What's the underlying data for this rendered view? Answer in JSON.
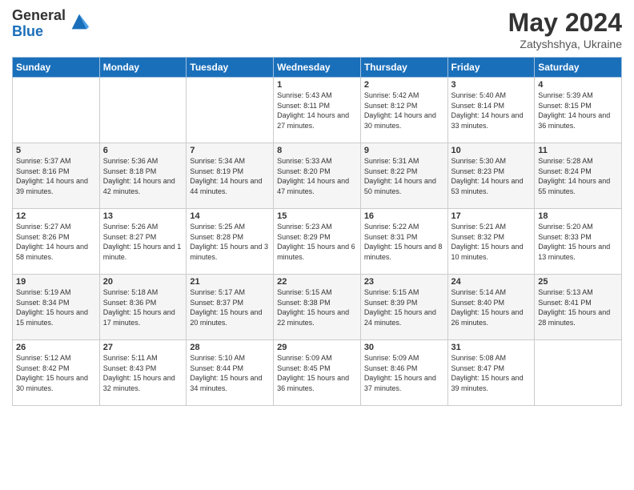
{
  "logo": {
    "general": "General",
    "blue": "Blue"
  },
  "header": {
    "month_year": "May 2024",
    "location": "Zatyshshya, Ukraine"
  },
  "days_of_week": [
    "Sunday",
    "Monday",
    "Tuesday",
    "Wednesday",
    "Thursday",
    "Friday",
    "Saturday"
  ],
  "weeks": [
    [
      {
        "day": "",
        "info": ""
      },
      {
        "day": "",
        "info": ""
      },
      {
        "day": "",
        "info": ""
      },
      {
        "day": "1",
        "info": "Sunrise: 5:43 AM\nSunset: 8:11 PM\nDaylight: 14 hours and 27 minutes."
      },
      {
        "day": "2",
        "info": "Sunrise: 5:42 AM\nSunset: 8:12 PM\nDaylight: 14 hours and 30 minutes."
      },
      {
        "day": "3",
        "info": "Sunrise: 5:40 AM\nSunset: 8:14 PM\nDaylight: 14 hours and 33 minutes."
      },
      {
        "day": "4",
        "info": "Sunrise: 5:39 AM\nSunset: 8:15 PM\nDaylight: 14 hours and 36 minutes."
      }
    ],
    [
      {
        "day": "5",
        "info": "Sunrise: 5:37 AM\nSunset: 8:16 PM\nDaylight: 14 hours and 39 minutes."
      },
      {
        "day": "6",
        "info": "Sunrise: 5:36 AM\nSunset: 8:18 PM\nDaylight: 14 hours and 42 minutes."
      },
      {
        "day": "7",
        "info": "Sunrise: 5:34 AM\nSunset: 8:19 PM\nDaylight: 14 hours and 44 minutes."
      },
      {
        "day": "8",
        "info": "Sunrise: 5:33 AM\nSunset: 8:20 PM\nDaylight: 14 hours and 47 minutes."
      },
      {
        "day": "9",
        "info": "Sunrise: 5:31 AM\nSunset: 8:22 PM\nDaylight: 14 hours and 50 minutes."
      },
      {
        "day": "10",
        "info": "Sunrise: 5:30 AM\nSunset: 8:23 PM\nDaylight: 14 hours and 53 minutes."
      },
      {
        "day": "11",
        "info": "Sunrise: 5:28 AM\nSunset: 8:24 PM\nDaylight: 14 hours and 55 minutes."
      }
    ],
    [
      {
        "day": "12",
        "info": "Sunrise: 5:27 AM\nSunset: 8:26 PM\nDaylight: 14 hours and 58 minutes."
      },
      {
        "day": "13",
        "info": "Sunrise: 5:26 AM\nSunset: 8:27 PM\nDaylight: 15 hours and 1 minute."
      },
      {
        "day": "14",
        "info": "Sunrise: 5:25 AM\nSunset: 8:28 PM\nDaylight: 15 hours and 3 minutes."
      },
      {
        "day": "15",
        "info": "Sunrise: 5:23 AM\nSunset: 8:29 PM\nDaylight: 15 hours and 6 minutes."
      },
      {
        "day": "16",
        "info": "Sunrise: 5:22 AM\nSunset: 8:31 PM\nDaylight: 15 hours and 8 minutes."
      },
      {
        "day": "17",
        "info": "Sunrise: 5:21 AM\nSunset: 8:32 PM\nDaylight: 15 hours and 10 minutes."
      },
      {
        "day": "18",
        "info": "Sunrise: 5:20 AM\nSunset: 8:33 PM\nDaylight: 15 hours and 13 minutes."
      }
    ],
    [
      {
        "day": "19",
        "info": "Sunrise: 5:19 AM\nSunset: 8:34 PM\nDaylight: 15 hours and 15 minutes."
      },
      {
        "day": "20",
        "info": "Sunrise: 5:18 AM\nSunset: 8:36 PM\nDaylight: 15 hours and 17 minutes."
      },
      {
        "day": "21",
        "info": "Sunrise: 5:17 AM\nSunset: 8:37 PM\nDaylight: 15 hours and 20 minutes."
      },
      {
        "day": "22",
        "info": "Sunrise: 5:15 AM\nSunset: 8:38 PM\nDaylight: 15 hours and 22 minutes."
      },
      {
        "day": "23",
        "info": "Sunrise: 5:15 AM\nSunset: 8:39 PM\nDaylight: 15 hours and 24 minutes."
      },
      {
        "day": "24",
        "info": "Sunrise: 5:14 AM\nSunset: 8:40 PM\nDaylight: 15 hours and 26 minutes."
      },
      {
        "day": "25",
        "info": "Sunrise: 5:13 AM\nSunset: 8:41 PM\nDaylight: 15 hours and 28 minutes."
      }
    ],
    [
      {
        "day": "26",
        "info": "Sunrise: 5:12 AM\nSunset: 8:42 PM\nDaylight: 15 hours and 30 minutes."
      },
      {
        "day": "27",
        "info": "Sunrise: 5:11 AM\nSunset: 8:43 PM\nDaylight: 15 hours and 32 minutes."
      },
      {
        "day": "28",
        "info": "Sunrise: 5:10 AM\nSunset: 8:44 PM\nDaylight: 15 hours and 34 minutes."
      },
      {
        "day": "29",
        "info": "Sunrise: 5:09 AM\nSunset: 8:45 PM\nDaylight: 15 hours and 36 minutes."
      },
      {
        "day": "30",
        "info": "Sunrise: 5:09 AM\nSunset: 8:46 PM\nDaylight: 15 hours and 37 minutes."
      },
      {
        "day": "31",
        "info": "Sunrise: 5:08 AM\nSunset: 8:47 PM\nDaylight: 15 hours and 39 minutes."
      },
      {
        "day": "",
        "info": ""
      }
    ]
  ]
}
